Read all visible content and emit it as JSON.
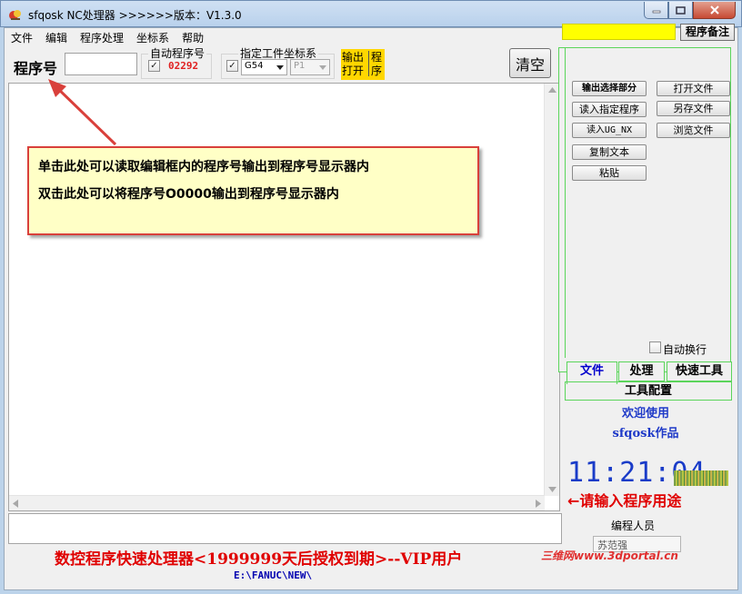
{
  "window": {
    "title": "sfqosk NC处理器 >>>>>>版本：V1.3.0"
  },
  "menu": [
    "文件",
    "编辑",
    "程序处理",
    "坐标系",
    "帮助"
  ],
  "toolbar": {
    "program_number_label": "程序号",
    "program_number_value": "",
    "auto_program_label": "自动程序号",
    "auto_program_checked": true,
    "auto_program_value": "02292",
    "workpiece_coord_label": "指定工件坐标系",
    "workpiece_coord_checked": true,
    "coord_select": "G54",
    "coord_select2": "P1",
    "output_open_label": "输出\n打开",
    "program_label": "程\n序",
    "clear_label": "清空"
  },
  "callout": {
    "line1": "单击此处可以读取编辑框内的程序号输出到程序号显示器内",
    "line2": "双击此处可以将程序号O0000输出到程序号显示器内"
  },
  "footer": {
    "license_text": "数控程序快速处理器<1999999天后授权到期>--VIP用户",
    "path": "E:\\FANUC\\NEW\\"
  },
  "right_panel": {
    "note_button": "程序备注",
    "buttons_left": [
      "输出选择部分",
      "读入指定程序",
      "读入UG_NX",
      "复制文本",
      "粘贴"
    ],
    "buttons_right": [
      "打开文件",
      "另存文件",
      "浏览文件"
    ],
    "auto_wrap_label": "自动换行",
    "auto_wrap_checked": false,
    "tabs": [
      "文件",
      "处理",
      "快速工具"
    ],
    "tools_config": "工具配置",
    "welcome": "欢迎使用",
    "author": "sfqosk作品",
    "clock": "11:21:04",
    "hint": "←请输入程序用途",
    "programmer_label": "编程人员",
    "programmer_value": "苏范强"
  },
  "watermark": "三维网www.3dportal.cn",
  "colors": {
    "accent_red": "#e00000",
    "callout_bg": "#ffffc6",
    "green_frame": "#5bd55b",
    "blue_text": "#1f3ac8",
    "yellow": "#ffd700"
  }
}
